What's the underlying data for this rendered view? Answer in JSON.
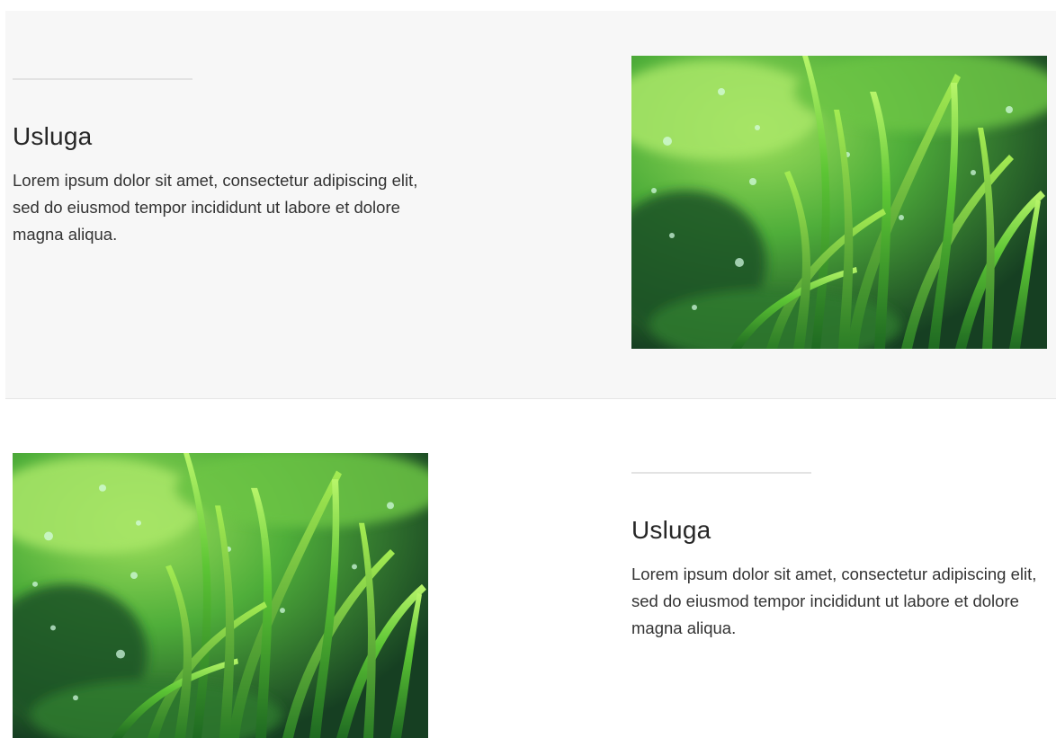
{
  "sections": [
    {
      "title": "Usluga",
      "description": "Lorem ipsum dolor sit amet, consectetur adipiscing elit, sed do eiusmod tempor incididunt ut labore et dolore magna aliqua.",
      "image": "grass-photo"
    },
    {
      "title": "Usluga",
      "description": "Lorem ipsum dolor sit amet, consectetur adipiscing elit, sed do eiusmod tempor incididunt ut labore et dolore magna aliqua.",
      "image": "grass-photo"
    }
  ],
  "colors": {
    "section_bg": "#f7f7f7",
    "rule": "#e3e3e3",
    "grass_dark": "#1c5a2a",
    "grass_light": "#8ee04a"
  }
}
